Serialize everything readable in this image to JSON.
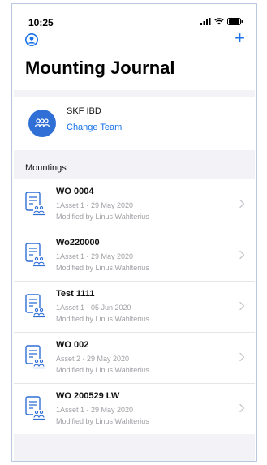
{
  "status_bar": {
    "time": "10:25"
  },
  "nav": {
    "add_label": "+"
  },
  "page": {
    "title": "Mounting Journal"
  },
  "team": {
    "name": "SKF IBD",
    "change_label": "Change Team"
  },
  "section": {
    "header": "Mountings"
  },
  "mountings": [
    {
      "title": "WO 0004",
      "subtitle": "1Asset 1 - 29 May 2020",
      "modified": "Modified by Linus Wahlterius"
    },
    {
      "title": "Wo220000",
      "subtitle": "1Asset 1 - 29 May 2020",
      "modified": "Modified by Linus Wahlterius"
    },
    {
      "title": "Test 1111",
      "subtitle": "1Asset 1 - 05 Jun 2020",
      "modified": "Modified by Linus Wahlterius"
    },
    {
      "title": "WO 002",
      "subtitle": "Asset 2 - 29 May 2020",
      "modified": "Modified by Linus Wahlterius"
    },
    {
      "title": "WO 200529 LW",
      "subtitle": "1Asset 1 - 29 May 2020",
      "modified": "Modified by Linus Wahlterius"
    }
  ],
  "colors": {
    "accent": "#1a73e8",
    "avatar": "#2f6fd6",
    "secondary_text": "#a0a0a6",
    "background": "#f2f2f7"
  },
  "icons": {
    "profile": "person-circle-icon",
    "team": "group-icon",
    "item": "document-team-icon",
    "chevron": "chevron-right-icon"
  }
}
